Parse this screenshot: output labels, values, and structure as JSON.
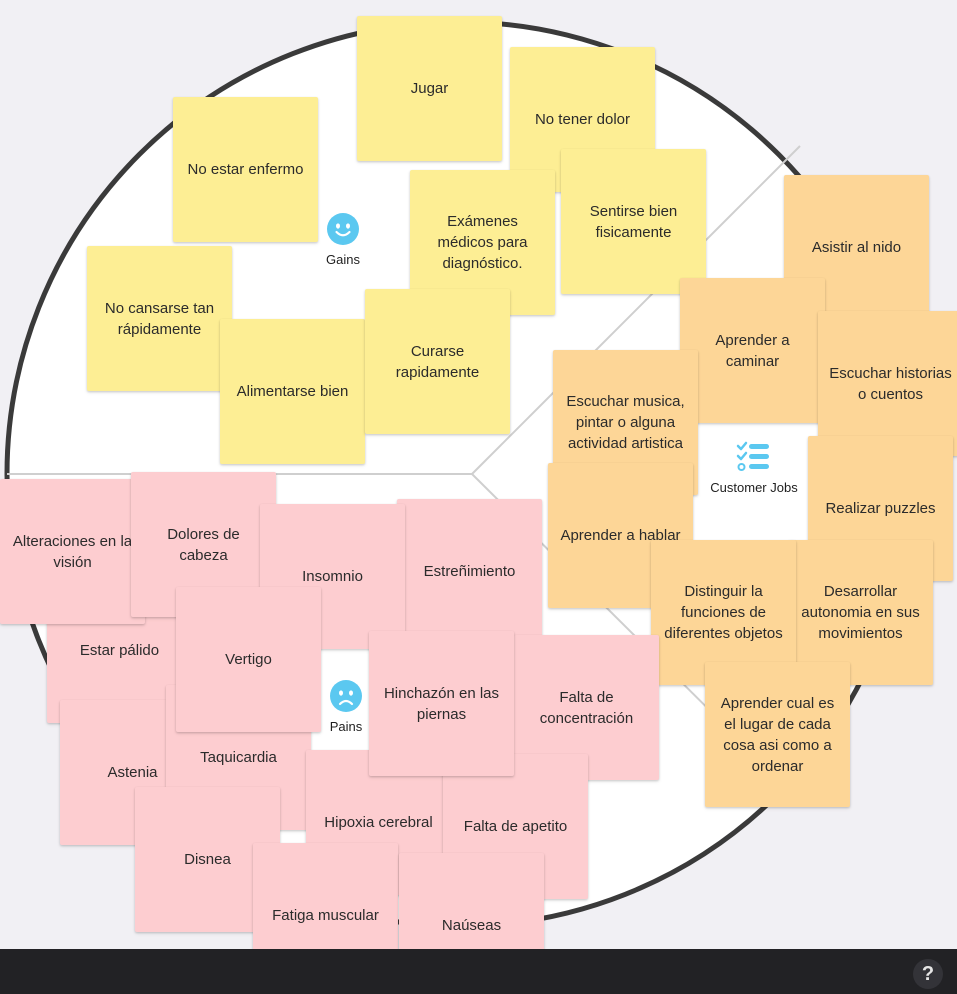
{
  "gains": {
    "label": "Gains",
    "notes": [
      "Jugar",
      "No tener dolor",
      "No estar enfermo",
      "Exámenes médicos para diagnóstico.",
      "Sentirse bien fisicamente",
      "No cansarse tan rápidamente",
      "Alimentarse bien",
      "Curarse rapidamente"
    ]
  },
  "customer_jobs": {
    "label": "Customer Jobs",
    "notes": [
      "Asistir al nido",
      "Aprender a caminar",
      "Escuchar historias o cuentos",
      "Escuchar musica, pintar o alguna actividad artistica",
      "Realizar puzzles",
      "Aprender a hablar",
      "Distinguir la funciones de diferentes objetos",
      "Desarrollar autonomia en sus movimientos",
      "Aprender cual es el lugar de cada cosa asi como a ordenar"
    ]
  },
  "pains": {
    "label": "Pains",
    "notes": [
      "Alteraciones en la visión",
      "Dolores de cabeza",
      "Insomnio",
      "Estreñimiento",
      "Estar pálido",
      "Vertigo",
      "Hinchazón en las piernas",
      "Falta de concentración",
      "Astenia",
      "Taquicardia",
      "Hipoxia cerebral",
      "Falta de apetito",
      "Disnea",
      "Fatiga muscular",
      "Naúseas"
    ]
  },
  "help": {
    "label": "?"
  },
  "colors": {
    "gain_note": "#fdee94",
    "job_note": "#fdd697",
    "pain_note": "#fdcdd0",
    "circle_outline": "#3a3a3a",
    "icon_blue": "#5bc8f0",
    "bottom_bar": "#222225"
  }
}
